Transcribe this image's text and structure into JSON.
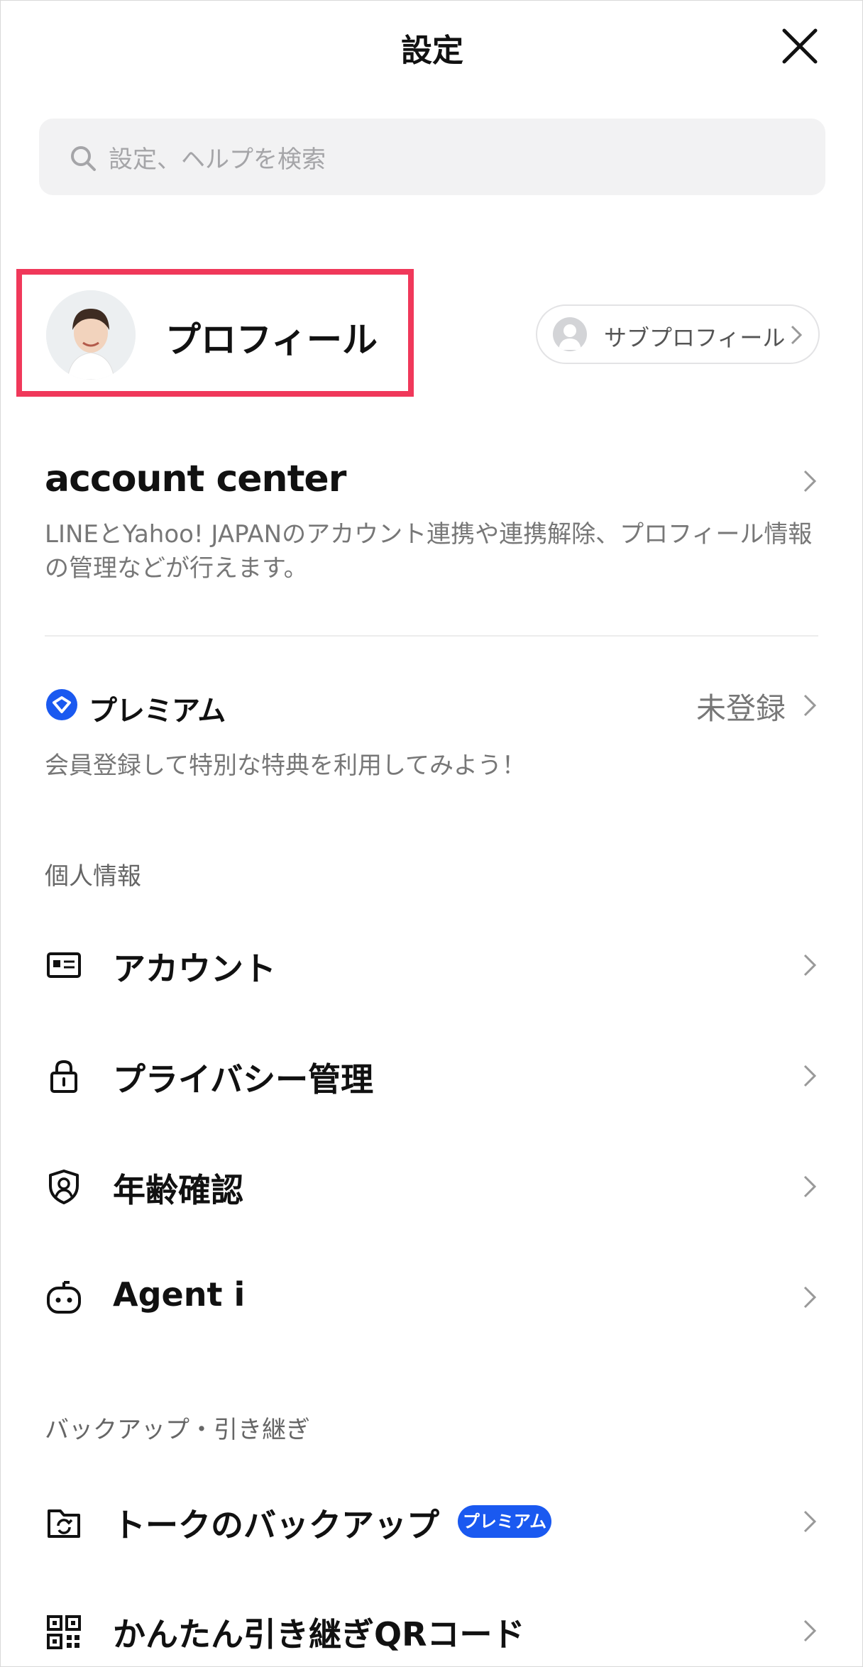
{
  "header": {
    "title": "設定"
  },
  "search": {
    "placeholder": "設定、ヘルプを検索"
  },
  "profile": {
    "label": "プロフィール",
    "sub_profile_label": "サブプロフィール"
  },
  "account_center": {
    "title": "account center",
    "description": "LINEとYahoo! JAPANのアカウント連携や連携解除、プロフィール情報の管理などが行えます。"
  },
  "premium": {
    "label": "プレミアム",
    "status": "未登録",
    "description": "会員登録して特別な特典を利用してみよう！"
  },
  "sections": [
    {
      "title": "個人情報",
      "items": [
        {
          "label": "アカウント",
          "icon": "id-card-icon"
        },
        {
          "label": "プライバシー管理",
          "icon": "lock-icon"
        },
        {
          "label": "年齢確認",
          "icon": "shield-person-icon"
        },
        {
          "label": "Agent i",
          "icon": "robot-icon"
        }
      ]
    },
    {
      "title": "バックアップ・引き継ぎ",
      "items": [
        {
          "label": "トークのバックアップ",
          "icon": "backup-folder-icon",
          "badge": "プレミアム"
        },
        {
          "label": "かんたん引き継ぎQRコード",
          "icon": "qr-code-icon"
        }
      ]
    }
  ],
  "colors": {
    "highlight": "#f0385a",
    "premium_blue": "#1a59f0",
    "search_bg": "#f2f2f3"
  }
}
